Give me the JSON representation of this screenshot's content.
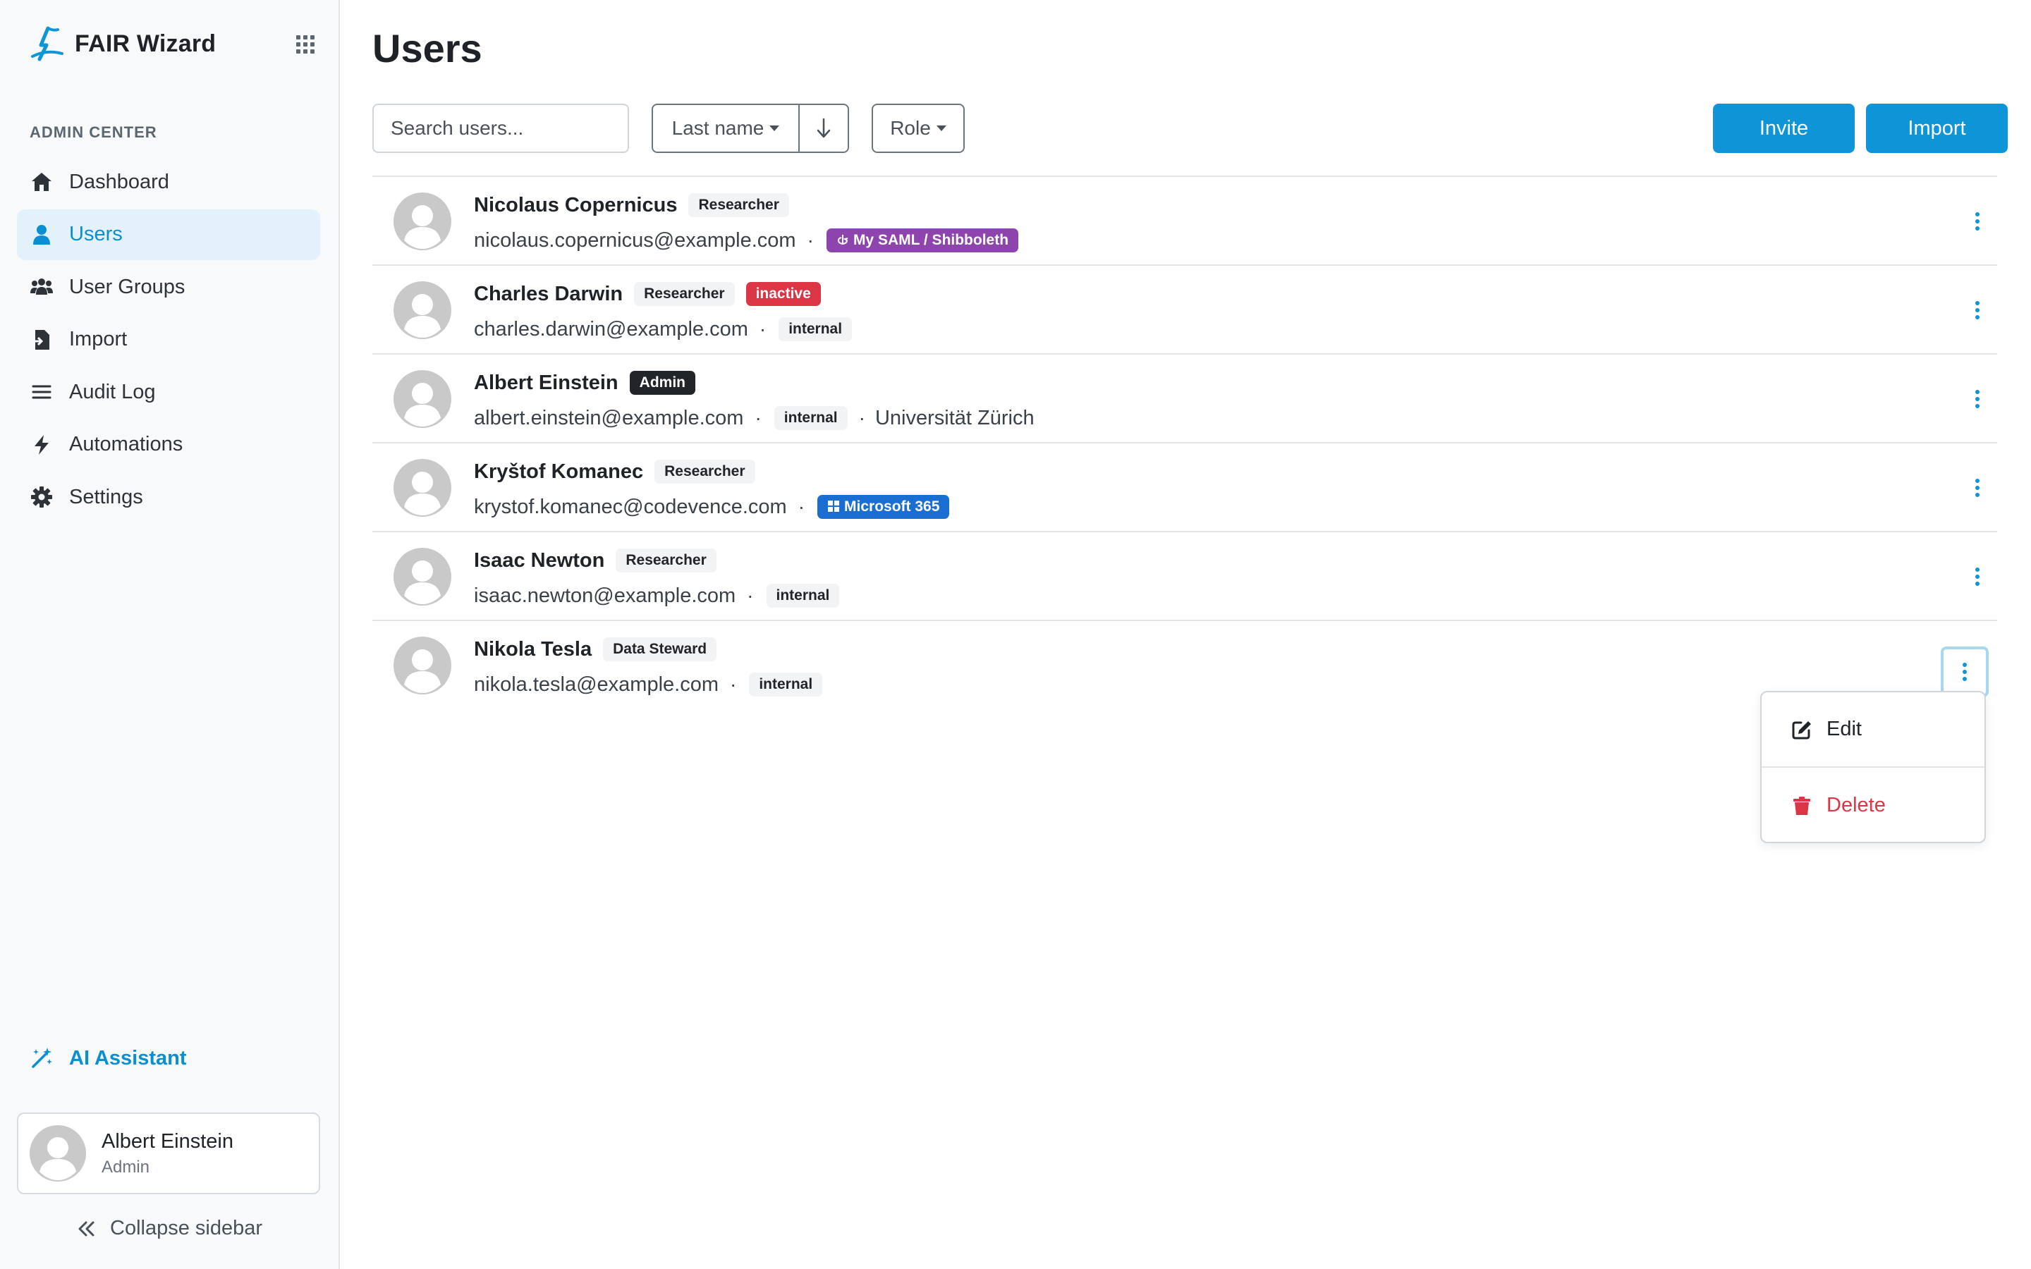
{
  "app": {
    "name": "FAIR Wizard"
  },
  "sidebar": {
    "section_title": "ADMIN CENTER",
    "items": [
      {
        "label": "Dashboard",
        "icon": "home-icon",
        "active": false
      },
      {
        "label": "Users",
        "icon": "user-icon",
        "active": true
      },
      {
        "label": "User Groups",
        "icon": "users-icon",
        "active": false
      },
      {
        "label": "Import",
        "icon": "import-icon",
        "active": false
      },
      {
        "label": "Audit Log",
        "icon": "list-icon",
        "active": false
      },
      {
        "label": "Automations",
        "icon": "bolt-icon",
        "active": false
      },
      {
        "label": "Settings",
        "icon": "gear-icon",
        "active": false
      }
    ],
    "ai_assistant": "AI Assistant",
    "profile": {
      "name": "Albert Einstein",
      "role": "Admin"
    },
    "collapse": "Collapse sidebar"
  },
  "page": {
    "title": "Users",
    "search": {
      "placeholder": "Search users..."
    },
    "sort": {
      "label": "Last name",
      "direction": "descending"
    },
    "role_filter": "Role",
    "invite_label": "Invite",
    "import_label": "Import"
  },
  "users": [
    {
      "name": "Nicolaus Copernicus",
      "role": "Researcher",
      "status": "",
      "email": "nicolaus.copernicus@example.com",
      "source": "My SAML / Shibboleth",
      "affiliation": ""
    },
    {
      "name": "Charles Darwin",
      "role": "Researcher",
      "status": "inactive",
      "email": "charles.darwin@example.com",
      "source": "internal",
      "affiliation": ""
    },
    {
      "name": "Albert Einstein",
      "role": "Admin",
      "status": "",
      "email": "albert.einstein@example.com",
      "source": "internal",
      "affiliation": "Universität Zürich"
    },
    {
      "name": "Kryštof Komanec",
      "role": "Researcher",
      "status": "",
      "email": "krystof.komanec@codevence.com",
      "source": "Microsoft 365",
      "affiliation": ""
    },
    {
      "name": "Isaac Newton",
      "role": "Researcher",
      "status": "",
      "email": "isaac.newton@example.com",
      "source": "internal",
      "affiliation": ""
    },
    {
      "name": "Nikola Tesla",
      "role": "Data Steward",
      "status": "",
      "email": "nikola.tesla@example.com",
      "source": "internal",
      "affiliation": ""
    }
  ],
  "dropdown": {
    "edit_label": "Edit",
    "delete_label": "Delete"
  },
  "colors": {
    "primary": "#0d95d8",
    "danger": "#dc3545",
    "saml": "#8e44ad",
    "microsoft": "#1b6ed1",
    "admin": "#212529"
  }
}
